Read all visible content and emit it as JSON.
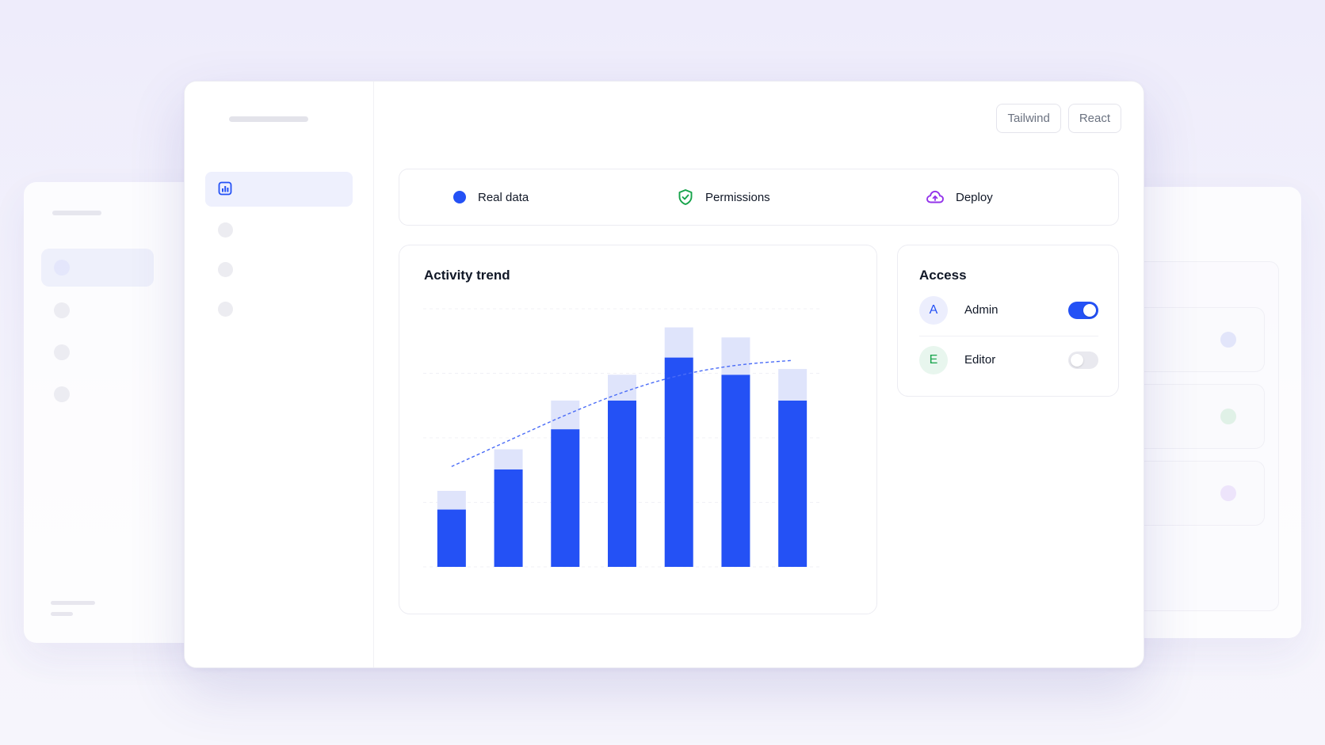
{
  "header": {
    "badges": [
      "Tailwind",
      "React"
    ]
  },
  "features": [
    {
      "label": "Real data",
      "icon": "dot-icon",
      "color": "#2451f5"
    },
    {
      "label": "Permissions",
      "icon": "shield-check-icon",
      "color": "#16a34a"
    },
    {
      "label": "Deploy",
      "icon": "cloud-upload-icon",
      "color": "#9333ea"
    }
  ],
  "sidebar": {
    "active_icon": "bar-chart-icon",
    "items_count": 4
  },
  "chart": {
    "title": "Activity trend"
  },
  "chart_data": {
    "type": "bar",
    "categories": [
      "",
      "",
      "",
      "",
      "",
      "",
      ""
    ],
    "series": [
      {
        "values": [
          20,
          34,
          48,
          58,
          73,
          67,
          58
        ],
        "color": "#2451f5"
      },
      {
        "values": [
          6.5,
          7,
          10,
          9,
          10.5,
          13,
          11
        ],
        "color": "#dfe4fb"
      }
    ],
    "trend_line": {
      "style": "dashed",
      "values": [
        35,
        44,
        53,
        61,
        67,
        70.5,
        72
      ]
    },
    "ylim": [
      0,
      90
    ],
    "grid": true,
    "stacked": true,
    "xlabel": "",
    "ylabel": ""
  },
  "access": {
    "title": "Access",
    "roles": [
      {
        "initial": "A",
        "name": "Admin",
        "enabled": true,
        "avatar_bg": "#eceefd",
        "avatar_fg": "#2451f5"
      },
      {
        "initial": "E",
        "name": "Editor",
        "enabled": false,
        "avatar_bg": "#e8f6ee",
        "avatar_fg": "#16a34a"
      }
    ]
  },
  "colors": {
    "accent": "#2451f5",
    "accent_light": "#dfe4fb",
    "background": "#eeecfb"
  }
}
